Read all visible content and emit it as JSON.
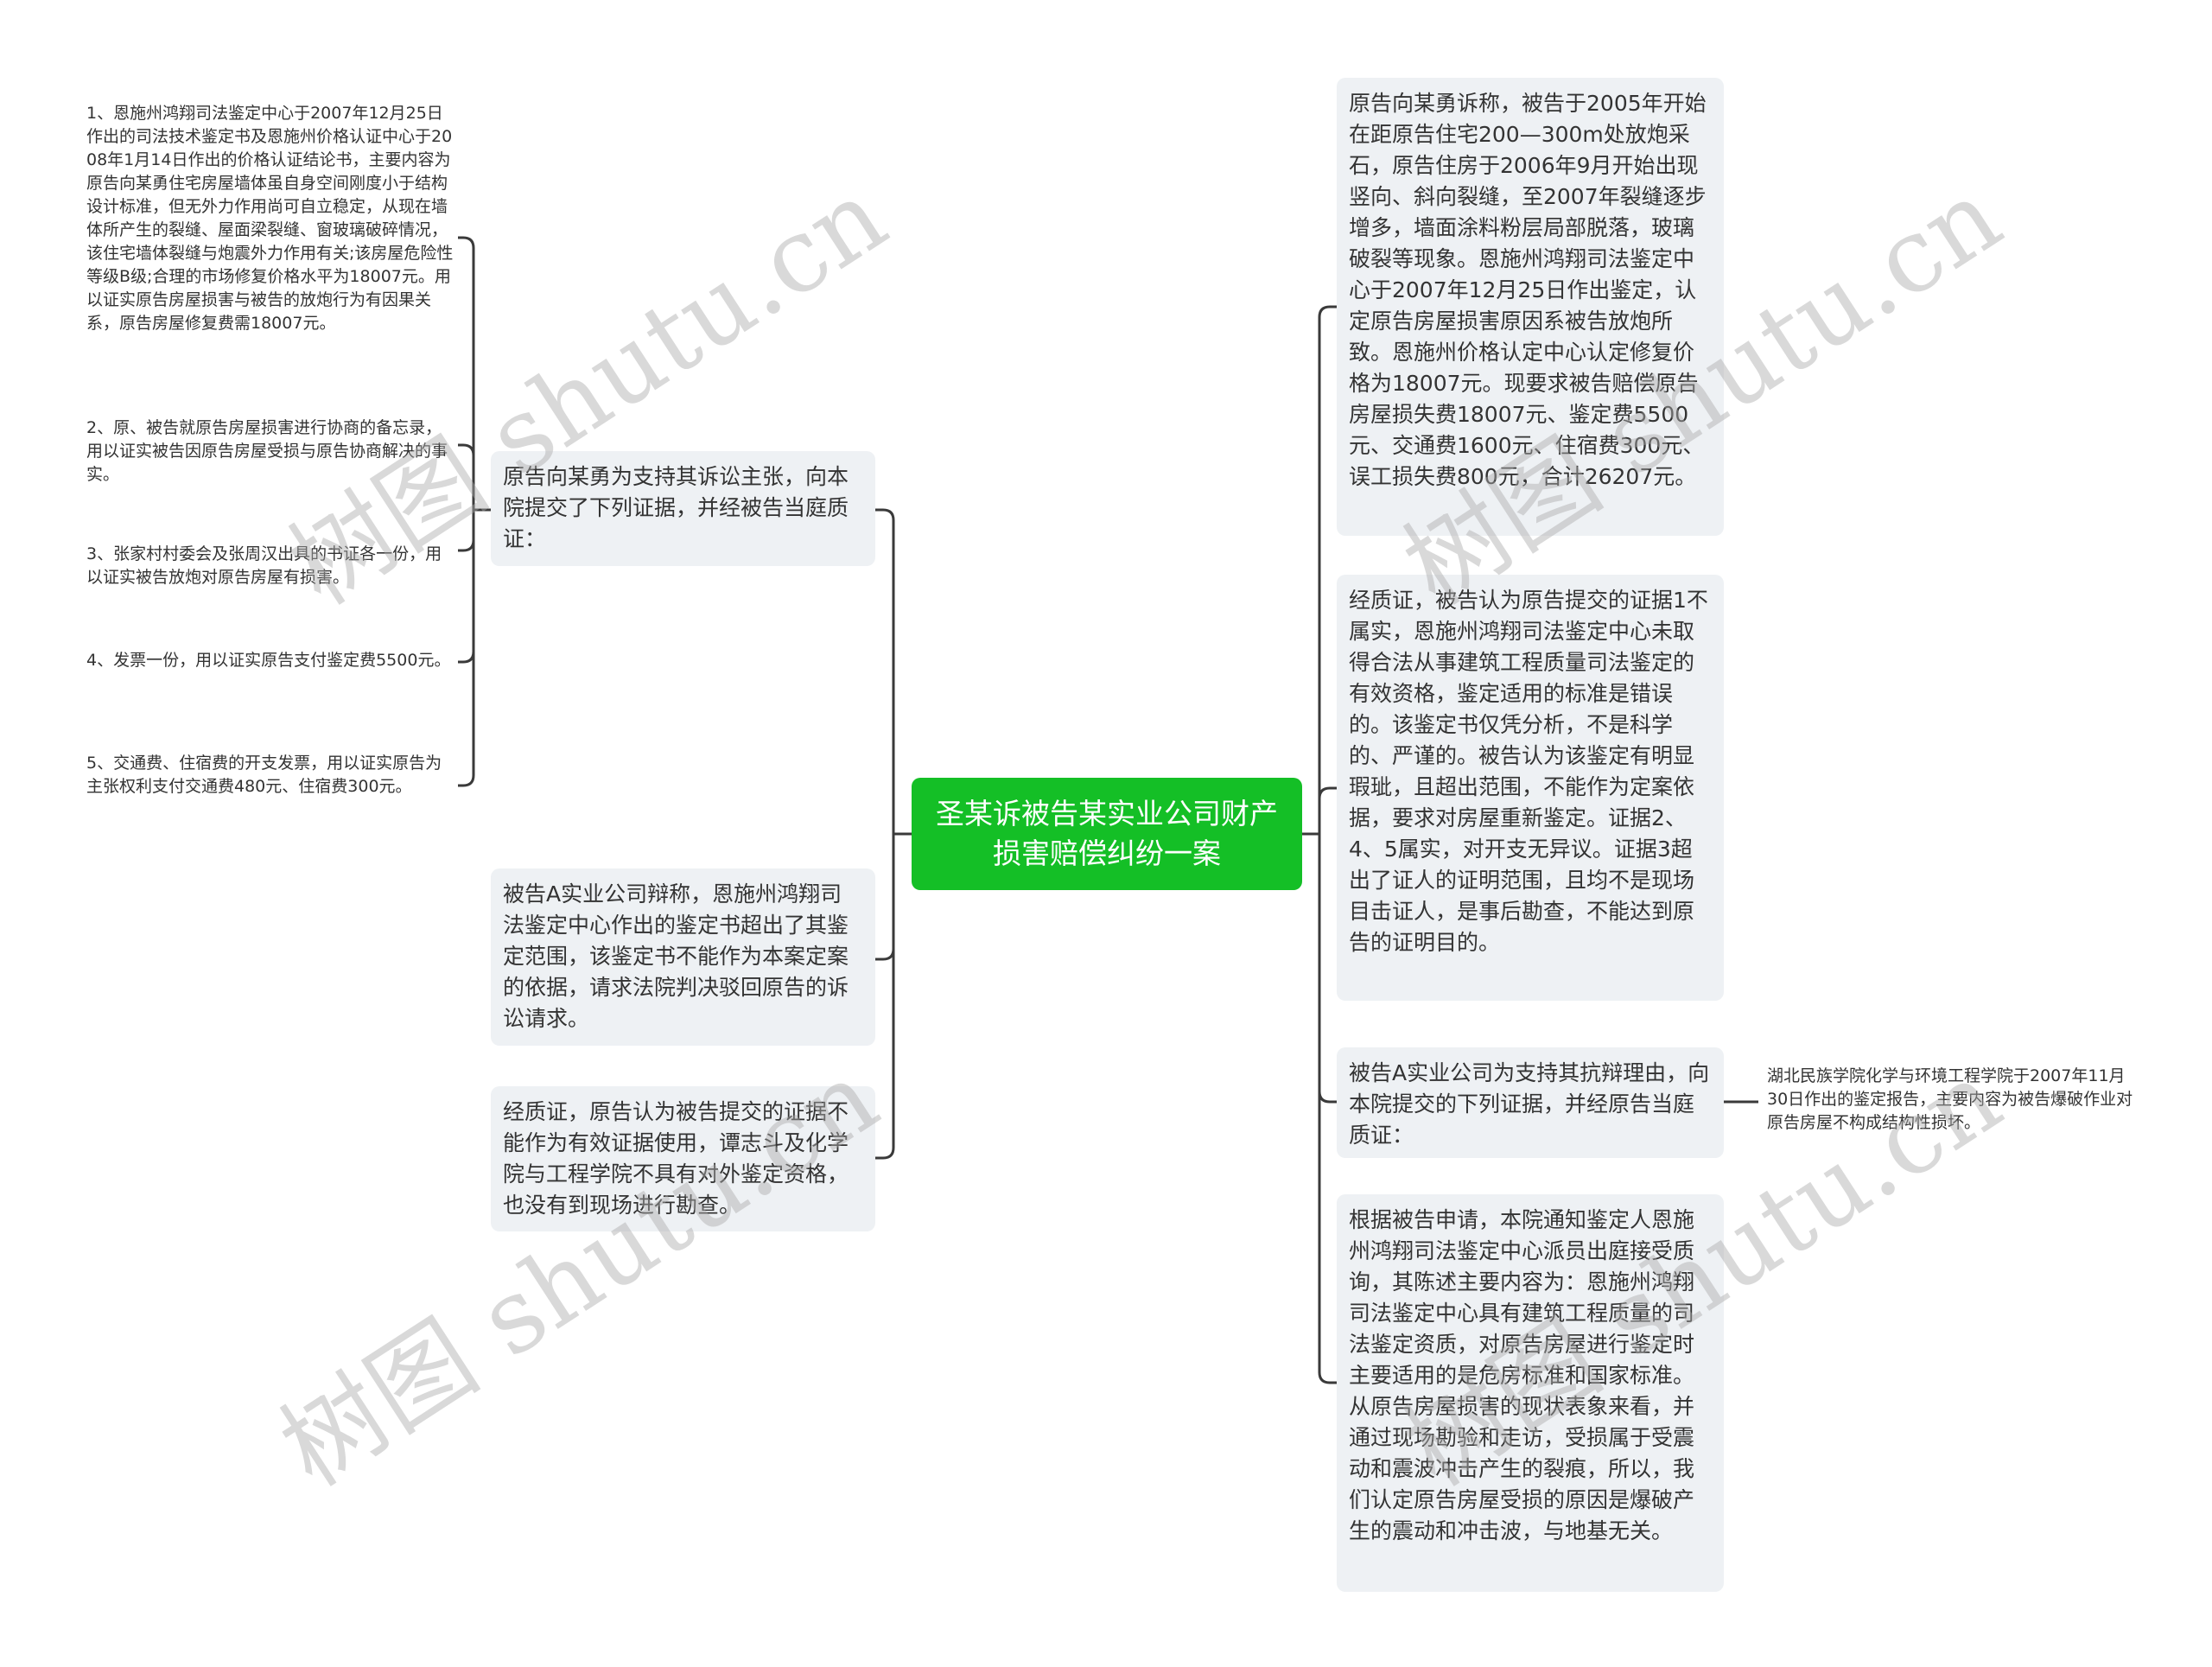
{
  "root": {
    "label": "圣某诉被告某实业公司财产损害赔偿纠纷一案"
  },
  "colors": {
    "root_bg": "#14bf26",
    "node_bg": "#eef1f4",
    "line": "#3a3a3a"
  },
  "left": {
    "plaintiff_evidence": {
      "label": "原告向某勇为支持其诉讼主张，向本院提交了下列证据，并经被告当庭质证：",
      "items": [
        "1、恩施州鸿翔司法鉴定中心于2007年12月25日作出的司法技术鉴定书及恩施州价格认证中心于2008年1月14日作出的价格认证结论书，主要内容为原告向某勇住宅房屋墙体虽自身空间刚度小于结构设计标准，但无外力作用尚可自立稳定，从现在墙体所产生的裂缝、屋面梁裂缝、窗玻璃破碎情况，该住宅墙体裂缝与炮震外力作用有关;该房屋危险性等级B级;合理的市场修复价格水平为18007元。用以证实原告房屋损害与被告的放炮行为有因果关系，原告房屋修复费需18007元。",
        "2、原、被告就原告房屋损害进行协商的备忘录，用以证实被告因原告房屋受损与原告协商解决的事实。",
        "3、张家村村委会及张周汉出具的书证各一份，用以证实被告放炮对原告房屋有损害。",
        "4、发票一份，用以证实原告支付鉴定费5500元。",
        "5、交通费、住宿费的开支发票，用以证实原告为主张权利支付交通费480元、住宿费300元。"
      ]
    },
    "defendant_defense": "被告A实业公司辩称，恩施州鸿翔司法鉴定中心作出的鉴定书超出了其鉴定范围，该鉴定书不能作为本案定案的依据，请求法院判决驳回原告的诉讼请求。",
    "plaintiff_cross_exam": "经质证，原告认为被告提交的证据不能作为有效证据使用，谭志斗及化学院与工程学院不具有对外鉴定资格，也没有到现场进行勘查。"
  },
  "right": {
    "plaintiff_claim": "原告向某勇诉称，被告于2005年开始在距原告住宅200—300m处放炮采石，原告住房于2006年9月开始出现竖向、斜向裂缝，至2007年裂缝逐步增多，墙面涂料粉层局部脱落，玻璃破裂等现象。恩施州鸿翔司法鉴定中心于2007年12月25日作出鉴定，认定原告房屋损害原因系被告放炮所致。恩施州价格认定中心认定修复价格为18007元。现要求被告赔偿原告房屋损失费18007元、鉴定费5500元、交通费1600元、住宿费300元、误工损失费800元，合计26207元。",
    "defendant_cross_exam": "经质证，被告认为原告提交的证据1不属实，恩施州鸿翔司法鉴定中心未取得合法从事建筑工程质量司法鉴定的有效资格，鉴定适用的标准是错误的。该鉴定书仅凭分析，不是科学的、严谨的。被告认为该鉴定有明显瑕玼，且超出范围，不能作为定案依据，要求对房屋重新鉴定。证据2、4、5属实，对开支无异议。证据3超出了证人的证明范围，且均不是现场目击证人，是事后勘查，不能达到原告的证明目的。",
    "defendant_evidence": {
      "label": "被告A实业公司为支持其抗辩理由，向本院提交的下列证据，并经原告当庭质证：",
      "items": [
        "湖北民族学院化学与环境工程学院于2007年11月30日作出的鉴定报告，主要内容为被告爆破作业对原告房屋不构成结构性损坏。"
      ]
    },
    "expert_testimony": "根据被告申请，本院通知鉴定人恩施州鸿翔司法鉴定中心派员出庭接受质询，其陈述主要内容为：恩施州鸿翔司法鉴定中心具有建筑工程质量的司法鉴定资质，对原告房屋进行鉴定时主要适用的是危房标准和国家标准。从原告房屋损害的现状表象来看，并通过现场勘验和走访，受损属于受震动和震波冲击产生的裂痕，所以，我们认定原告房屋受损的原因是爆破产生的震动和冲击波，与地基无关。"
  },
  "watermark": {
    "text": "树图 shutu.cn"
  }
}
